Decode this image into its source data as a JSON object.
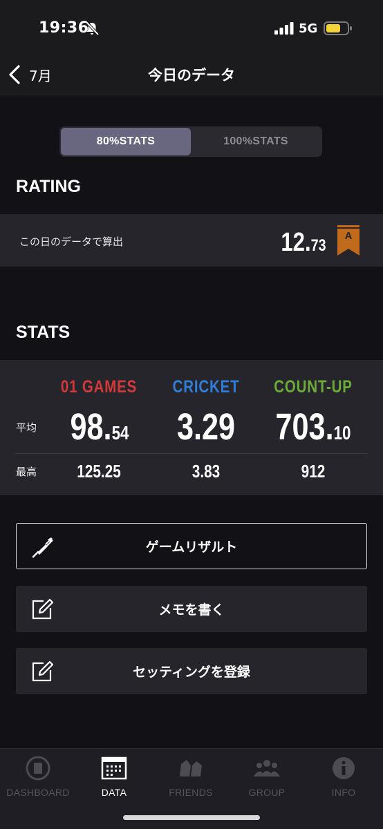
{
  "status_bar": {
    "time": "19:36",
    "network": "5G"
  },
  "nav": {
    "back_label": "7月",
    "title": "今日のデータ"
  },
  "segments": [
    {
      "label": "80%STATS",
      "active": true
    },
    {
      "label": "100%STATS",
      "active": false
    }
  ],
  "rating": {
    "section_title": "RATING",
    "description": "この日のデータで算出",
    "value_int": "12.",
    "value_dec": "73",
    "class_letter": "A",
    "flag_color": "#c06a1b"
  },
  "stats": {
    "section_title": "STATS",
    "row_avg_label": "平均",
    "row_max_label": "最高",
    "columns": [
      {
        "name": "01 GAMES",
        "color": "#d1393b",
        "avg_int": "98.",
        "avg_dec": "54",
        "max": "125.25"
      },
      {
        "name": "CRICKET",
        "color": "#2f7ed8",
        "avg_int": "3.29",
        "avg_dec": "",
        "max": "3.83"
      },
      {
        "name": "COUNT-UP",
        "color": "#6cad3a",
        "avg_int": "703.",
        "avg_dec": "10",
        "max": "912"
      }
    ]
  },
  "actions": [
    {
      "label": "ゲームリザルト",
      "icon": "dart-icon"
    },
    {
      "label": "メモを書く",
      "icon": "edit-icon"
    },
    {
      "label": "セッティングを登録",
      "icon": "edit-icon"
    }
  ],
  "tabs": [
    {
      "label": "DASHBOARD",
      "icon": "dashboard-icon",
      "active": false
    },
    {
      "label": "DATA",
      "icon": "calendar-icon",
      "active": true
    },
    {
      "label": "FRIENDS",
      "icon": "friends-icon",
      "active": false
    },
    {
      "label": "GROUP",
      "icon": "group-icon",
      "active": false
    },
    {
      "label": "INFO",
      "icon": "info-icon",
      "active": false
    }
  ]
}
